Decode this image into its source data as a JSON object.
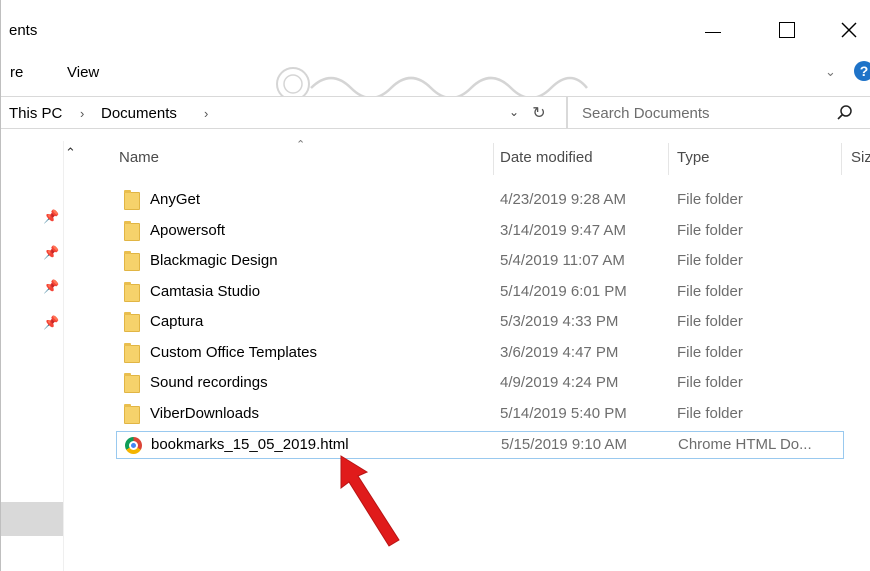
{
  "window": {
    "title": "ents",
    "controls": {
      "minimize": "minimize",
      "maximize": "maximize",
      "close": "close"
    }
  },
  "ribbon": {
    "tabs": [
      "re",
      "View"
    ],
    "help_label": "?"
  },
  "address": {
    "breadcrumbs": [
      "This PC",
      "Documents"
    ],
    "separator": "›"
  },
  "search": {
    "placeholder": "Search Documents"
  },
  "columns": {
    "name": "Name",
    "date": "Date modified",
    "type": "Type",
    "size": "Siz"
  },
  "files": [
    {
      "name": "AnyGet",
      "date": "4/23/2019 9:28 AM",
      "type": "File folder",
      "icon": "folder-icon"
    },
    {
      "name": "Apowersoft",
      "date": "3/14/2019 9:47 AM",
      "type": "File folder",
      "icon": "folder-icon"
    },
    {
      "name": "Blackmagic Design",
      "date": "5/4/2019 11:07 AM",
      "type": "File folder",
      "icon": "folder-icon"
    },
    {
      "name": "Camtasia Studio",
      "date": "5/14/2019 6:01 PM",
      "type": "File folder",
      "icon": "folder-icon"
    },
    {
      "name": "Captura",
      "date": "5/3/2019 4:33 PM",
      "type": "File folder",
      "icon": "folder-icon"
    },
    {
      "name": "Custom Office Templates",
      "date": "3/6/2019 4:47 PM",
      "type": "File folder",
      "icon": "folder-icon"
    },
    {
      "name": "Sound recordings",
      "date": "4/9/2019 4:24 PM",
      "type": "File folder",
      "icon": "folder-icon"
    },
    {
      "name": "ViberDownloads",
      "date": "5/14/2019 5:40 PM",
      "type": "File folder",
      "icon": "folder-icon"
    },
    {
      "name": "bookmarks_15_05_2019.html",
      "date": "5/15/2019 9:10 AM",
      "type": "Chrome HTML Do...",
      "icon": "chrome-icon"
    }
  ],
  "colors": {
    "selection_border": "#99c9ef",
    "help_blue": "#1e73c8",
    "annotation_arrow": "#e01b1b",
    "folder_yellow": "#f6d26b"
  }
}
